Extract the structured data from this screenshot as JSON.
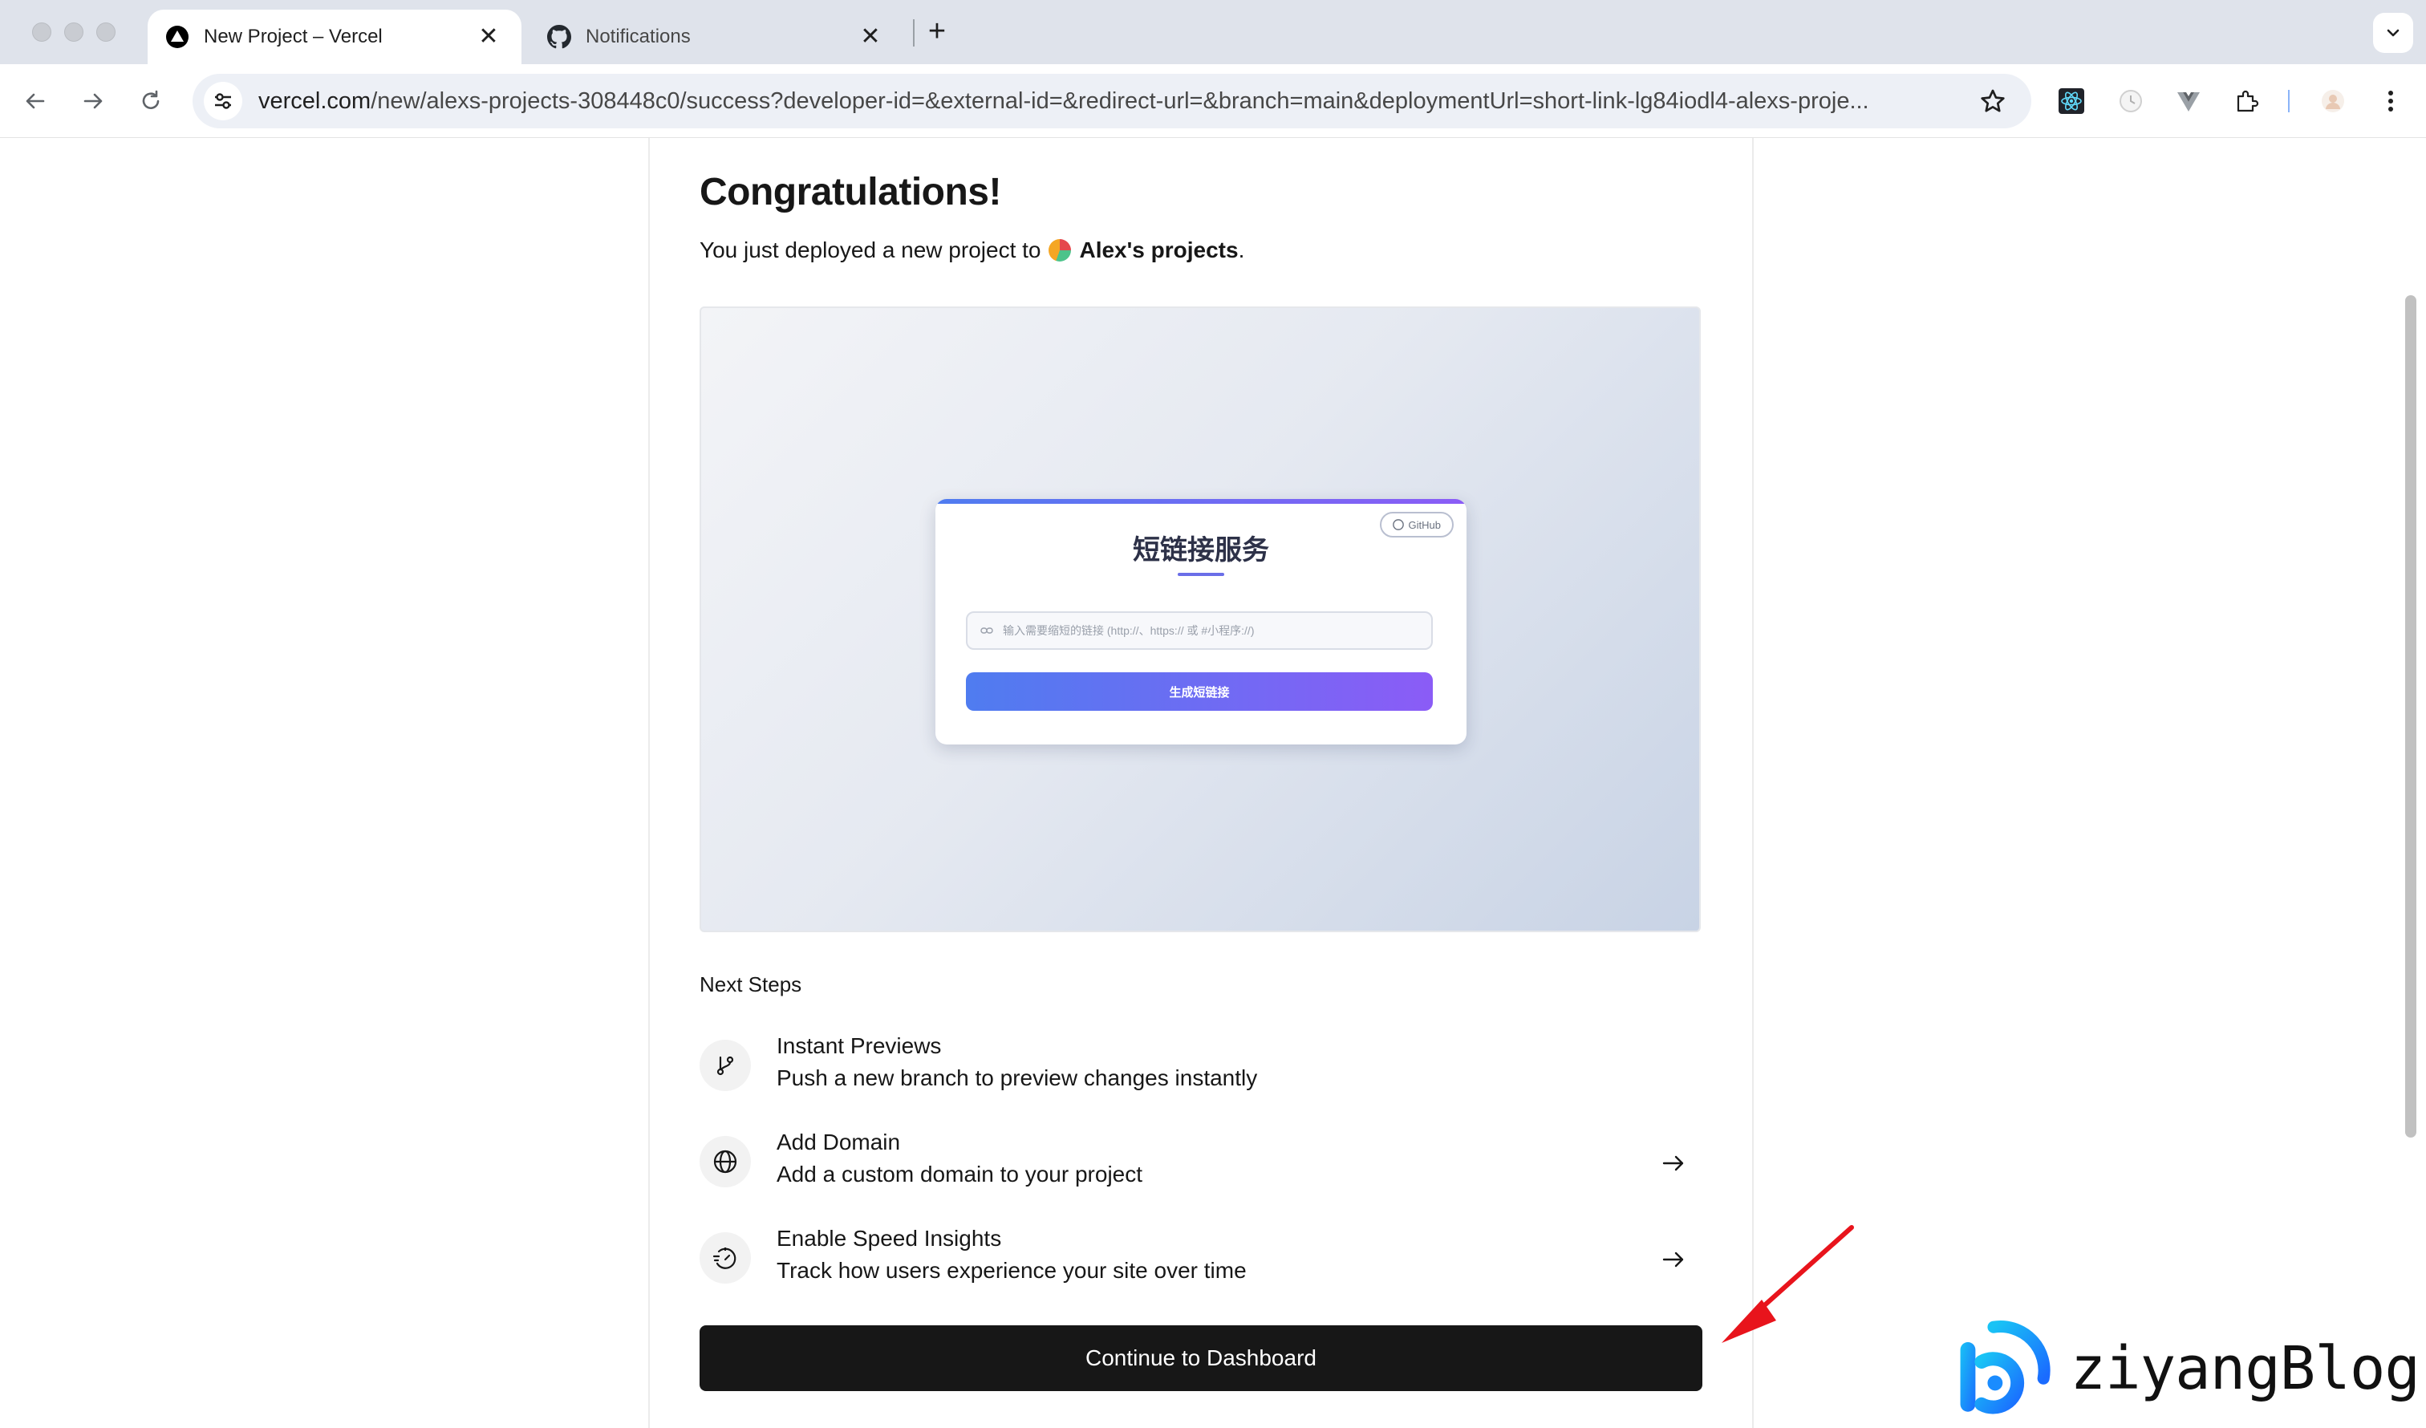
{
  "browser": {
    "tabs": [
      {
        "title": "New Project – Vercel",
        "active": true,
        "icon": "vercel-logo-icon"
      },
      {
        "title": "Notifications",
        "active": false,
        "icon": "github-logo-icon"
      }
    ],
    "close_glyph": "✕",
    "new_tab_glyph": "+",
    "url_domain": "vercel.com",
    "url_path": "/new/alexs-projects-308448c0/success?developer-id=&external-id=&redirect-url=&branch=main&deploymentUrl=short-link-lg84iodl4-alexs-proje..."
  },
  "page": {
    "heading": "Congratulations!",
    "deployed_prefix": "You just deployed a new project to",
    "team_name": "Alex's projects",
    "deployed_suffix": ".",
    "preview": {
      "github_label": "GitHub",
      "app_title": "短链接服务",
      "input_placeholder": "输入需要缩短的链接 (http://、https:// 或 #小程序://)",
      "button_label": "生成短链接"
    },
    "next_steps_label": "Next Steps",
    "steps": [
      {
        "title": "Instant Previews",
        "description": "Push a new branch to preview changes instantly",
        "icon": "git-branch-icon",
        "has_arrow": false
      },
      {
        "title": "Add Domain",
        "description": "Add a custom domain to your project",
        "icon": "globe-icon",
        "has_arrow": true
      },
      {
        "title": "Enable Speed Insights",
        "description": "Track how users experience your site over time",
        "icon": "speed-gauge-icon",
        "has_arrow": true
      }
    ],
    "continue_button": "Continue to Dashboard"
  },
  "watermark": {
    "text": "ziyangBlog"
  },
  "colors": {
    "button_bg": "#171717",
    "annotation_arrow": "#e8141c",
    "watermark_blue": "#1a8cff"
  }
}
